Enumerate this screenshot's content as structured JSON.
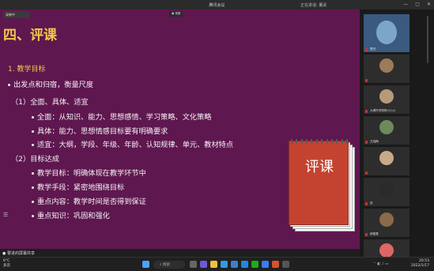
{
  "window": {
    "title": "腾讯会议",
    "speaker": "正在讲话: 董武"
  },
  "recording": "录制中",
  "view_toolbar": "▣ 视图",
  "slide": {
    "heading": "四、评课",
    "subheading": "1. 教学目标",
    "lines": [
      {
        "text": "出发点和归宿，衡量尺度",
        "dot": true
      },
      {
        "text": "（1）全面、具体、适宜",
        "dot": false
      },
      {
        "text": "全面：从知识、能力、思想感情、学习策略、文化策略",
        "dot": true
      },
      {
        "text": "具体：能力、思想情感目标要有明确要求",
        "dot": true
      },
      {
        "text": "适宜：大纲，学段、年级、年龄、认知规律、单元、教材特点",
        "dot": true
      },
      {
        "text": "（2）目标达成",
        "dot": false
      },
      {
        "text": "教学目标：明确体现在教学环节中",
        "dot": true
      },
      {
        "text": "教学手段：紧密地围绕目标",
        "dot": true
      },
      {
        "text": "重点内容：教学时间是否得到保证",
        "dot": true
      },
      {
        "text": "重点知识：巩固和强化",
        "dot": true
      }
    ],
    "notepad_text": "评课"
  },
  "share_notice": "● 曹进的屏幕共享",
  "participants": [
    {
      "name": "曹进",
      "color": "#7ba6c9"
    },
    {
      "name": "",
      "color": "#9a7b5a"
    },
    {
      "name": "大理市学院附小小六",
      "color": "#b69a7a"
    },
    {
      "name": "王晓梅",
      "color": "#6d8a5c"
    },
    {
      "name": "",
      "color": "#c9a98a"
    },
    {
      "name": "张",
      "color": "#2a2a2a"
    },
    {
      "name": "柳盈雪",
      "color": "#8a6a4a"
    },
    {
      "name": "林慧梅",
      "color": "#d66"
    }
  ],
  "taskbar": {
    "weather_temp": "6°C",
    "weather_desc": "多云",
    "search_placeholder": "搜索",
    "time": "20:53",
    "date": "2022/1/17"
  }
}
